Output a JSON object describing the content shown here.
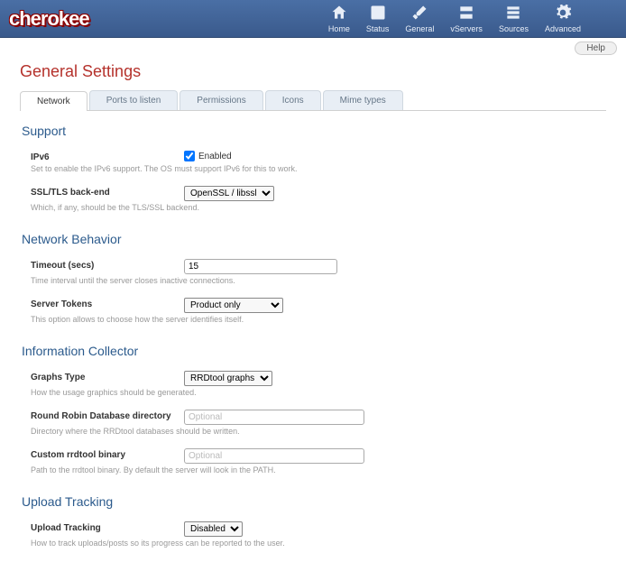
{
  "app": {
    "logo": "cherokee"
  },
  "nav": {
    "home": "Home",
    "status": "Status",
    "general": "General",
    "vservers": "vServers",
    "sources": "Sources",
    "advanced": "Advanced"
  },
  "help_btn": "Help",
  "page_title": "General Settings",
  "tabs": {
    "network": "Network",
    "ports": "Ports to listen",
    "permissions": "Permissions",
    "icons": "Icons",
    "mime": "Mime types"
  },
  "sections": {
    "support": {
      "title": "Support",
      "ipv6": {
        "label": "IPv6",
        "checkbox_label": "Enabled",
        "checked": true,
        "help": "Set to enable the IPv6 support. The OS must support IPv6 for this to work."
      },
      "ssl": {
        "label": "SSL/TLS back-end",
        "value": "OpenSSL / libssl",
        "help": "Which, if any, should be the TLS/SSL backend."
      }
    },
    "network": {
      "title": "Network Behavior",
      "timeout": {
        "label": "Timeout (secs)",
        "value": "15",
        "help": "Time interval until the server closes inactive connections."
      },
      "tokens": {
        "label": "Server Tokens",
        "value": "Product only",
        "help": "This option allows to choose how the server identifies itself."
      }
    },
    "collector": {
      "title": "Information Collector",
      "graphs": {
        "label": "Graphs Type",
        "value": "RRDtool graphs",
        "help": "How the usage graphics should be generated."
      },
      "rrddir": {
        "label": "Round Robin Database directory",
        "placeholder": "Optional",
        "value": "",
        "help": "Directory where the RRDtool databases should be written."
      },
      "rrdbin": {
        "label": "Custom rrdtool binary",
        "placeholder": "Optional",
        "value": "",
        "help": "Path to the rrdtool binary. By default the server will look in the PATH."
      }
    },
    "upload": {
      "title": "Upload Tracking",
      "tracking": {
        "label": "Upload Tracking",
        "value": "Disabled",
        "help": "How to track uploads/posts so its progress can be reported to the user."
      }
    }
  }
}
